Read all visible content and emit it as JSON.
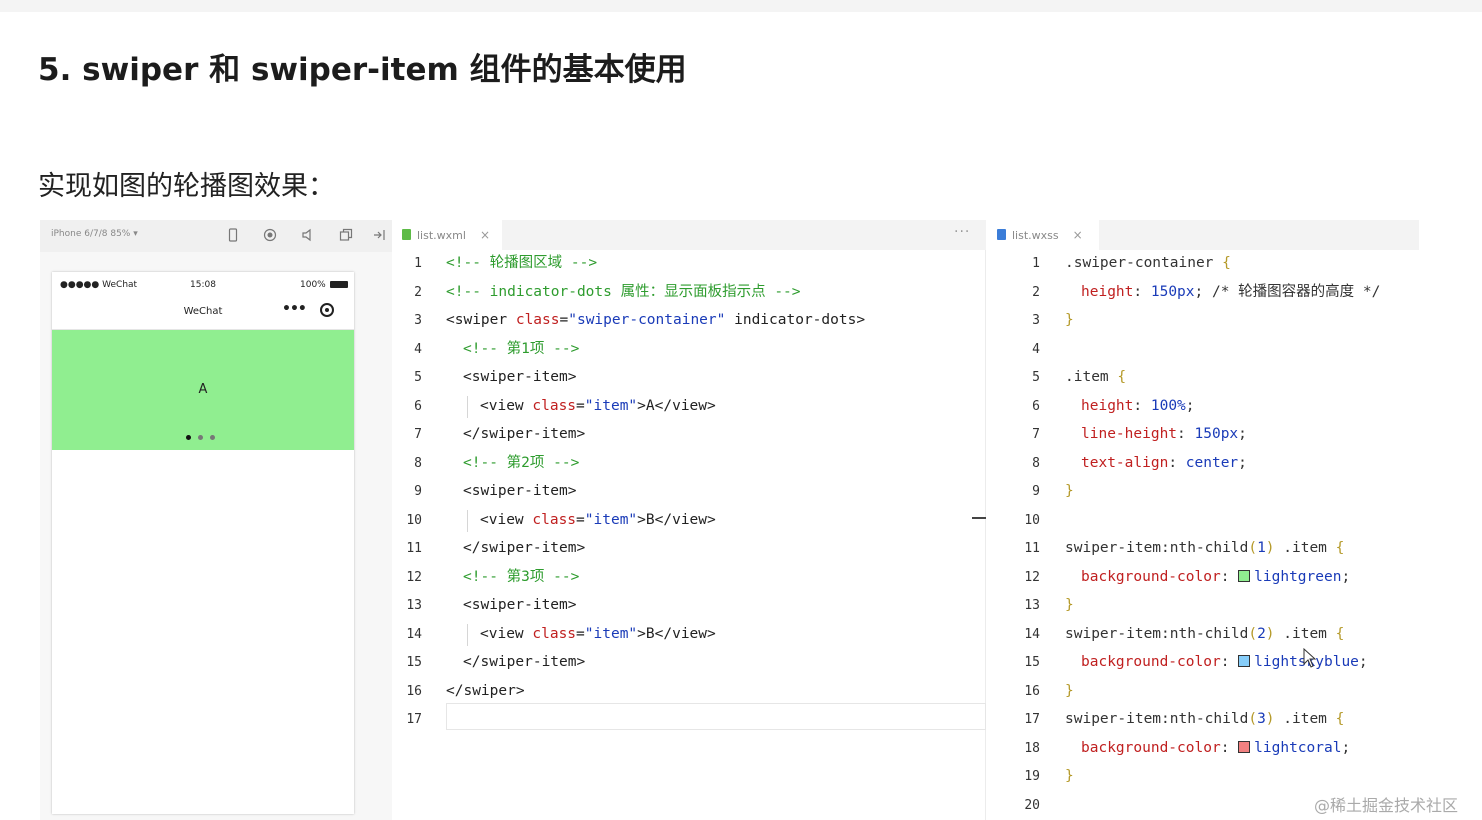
{
  "slide": {
    "title": "5. swiper 和 swiper-item 组件的基本使用",
    "subtitle": "实现如图的轮播图效果："
  },
  "simulator": {
    "device": "iPhone 6/7/8 85% ▾",
    "status_left": "●●●●● WeChat",
    "status_time": "15:08",
    "status_battery": "100%",
    "nav_title": "WeChat",
    "nav_more": "•••",
    "swiper_text": "A",
    "swiper_color": "#90ee90",
    "dots_count": 3,
    "dots_active": 1
  },
  "wxml_editor": {
    "tab_name": "list.wxml",
    "tab_close": "×",
    "more": "···",
    "lines": [
      {
        "n": "1",
        "indent": 0,
        "tokens": [
          {
            "t": "<!-- 轮播图区域 -->",
            "c": "comment"
          }
        ]
      },
      {
        "n": "2",
        "indent": 0,
        "tokens": [
          {
            "t": "<!-- indicator-dots 属性：显示面板指示点 -->",
            "c": "comment"
          }
        ]
      },
      {
        "n": "3",
        "indent": 0,
        "tokens": [
          {
            "t": "<swiper ",
            "c": "tag"
          },
          {
            "t": "class",
            "c": "attr"
          },
          {
            "t": "=",
            "c": "tag"
          },
          {
            "t": "\"swiper-container\"",
            "c": "str"
          },
          {
            "t": " indicator-dots>",
            "c": "tag"
          }
        ]
      },
      {
        "n": "4",
        "indent": 1,
        "tokens": [
          {
            "t": "<!-- 第1项 -->",
            "c": "comment"
          }
        ]
      },
      {
        "n": "5",
        "indent": 1,
        "tokens": [
          {
            "t": "<swiper-item>",
            "c": "tag"
          }
        ]
      },
      {
        "n": "6",
        "indent": 2,
        "tokens": [
          {
            "t": "<view ",
            "c": "tag"
          },
          {
            "t": "class",
            "c": "attr"
          },
          {
            "t": "=",
            "c": "tag"
          },
          {
            "t": "\"item\"",
            "c": "str"
          },
          {
            "t": ">A</view>",
            "c": "tag"
          }
        ]
      },
      {
        "n": "7",
        "indent": 1,
        "tokens": [
          {
            "t": "</swiper-item>",
            "c": "tag"
          }
        ]
      },
      {
        "n": "8",
        "indent": 1,
        "tokens": [
          {
            "t": "<!-- 第2项 -->",
            "c": "comment"
          }
        ]
      },
      {
        "n": "9",
        "indent": 1,
        "tokens": [
          {
            "t": "<swiper-item>",
            "c": "tag"
          }
        ]
      },
      {
        "n": "10",
        "indent": 2,
        "tokens": [
          {
            "t": "<view ",
            "c": "tag"
          },
          {
            "t": "class",
            "c": "attr"
          },
          {
            "t": "=",
            "c": "tag"
          },
          {
            "t": "\"item\"",
            "c": "str"
          },
          {
            "t": ">B</view>",
            "c": "tag"
          }
        ]
      },
      {
        "n": "11",
        "indent": 1,
        "tokens": [
          {
            "t": "</swiper-item>",
            "c": "tag"
          }
        ]
      },
      {
        "n": "12",
        "indent": 1,
        "tokens": [
          {
            "t": "<!-- 第3项 -->",
            "c": "comment"
          }
        ]
      },
      {
        "n": "13",
        "indent": 1,
        "tokens": [
          {
            "t": "<swiper-item>",
            "c": "tag"
          }
        ]
      },
      {
        "n": "14",
        "indent": 2,
        "tokens": [
          {
            "t": "<view ",
            "c": "tag"
          },
          {
            "t": "class",
            "c": "attr"
          },
          {
            "t": "=",
            "c": "tag"
          },
          {
            "t": "\"item\"",
            "c": "str"
          },
          {
            "t": ">B</view>",
            "c": "tag"
          }
        ]
      },
      {
        "n": "15",
        "indent": 1,
        "tokens": [
          {
            "t": "</swiper-item>",
            "c": "tag"
          }
        ]
      },
      {
        "n": "16",
        "indent": 0,
        "tokens": [
          {
            "t": "</swiper>",
            "c": "tag"
          }
        ]
      },
      {
        "n": "17",
        "indent": 0,
        "tokens": []
      }
    ]
  },
  "wxss_editor": {
    "tab_name": "list.wxss",
    "tab_close": "×",
    "lines": [
      {
        "n": "1",
        "indent": 0,
        "tokens": [
          {
            "t": ".swiper-container ",
            "c": "sel"
          },
          {
            "t": "{",
            "c": "brace"
          }
        ]
      },
      {
        "n": "2",
        "indent": 1,
        "tokens": [
          {
            "t": "height",
            "c": "prop"
          },
          {
            "t": ": ",
            "c": "punc"
          },
          {
            "t": "150px",
            "c": "val"
          },
          {
            "t": "; ",
            "c": "punc"
          },
          {
            "t": "/* 轮播图容器的高度 */",
            "c": "sel"
          }
        ]
      },
      {
        "n": "3",
        "indent": 0,
        "tokens": [
          {
            "t": "}",
            "c": "brace"
          }
        ]
      },
      {
        "n": "4",
        "indent": 0,
        "tokens": []
      },
      {
        "n": "5",
        "indent": 0,
        "tokens": [
          {
            "t": ".item ",
            "c": "sel"
          },
          {
            "t": "{",
            "c": "brace"
          }
        ]
      },
      {
        "n": "6",
        "indent": 1,
        "tokens": [
          {
            "t": "height",
            "c": "prop"
          },
          {
            "t": ": ",
            "c": "punc"
          },
          {
            "t": "100%",
            "c": "val"
          },
          {
            "t": ";",
            "c": "punc"
          }
        ]
      },
      {
        "n": "7",
        "indent": 1,
        "tokens": [
          {
            "t": "line-height",
            "c": "prop"
          },
          {
            "t": ": ",
            "c": "punc"
          },
          {
            "t": "150px",
            "c": "val"
          },
          {
            "t": ";",
            "c": "punc"
          }
        ]
      },
      {
        "n": "8",
        "indent": 1,
        "tokens": [
          {
            "t": "text-align",
            "c": "prop"
          },
          {
            "t": ": ",
            "c": "punc"
          },
          {
            "t": "center",
            "c": "val"
          },
          {
            "t": ";",
            "c": "punc"
          }
        ]
      },
      {
        "n": "9",
        "indent": 0,
        "tokens": [
          {
            "t": "}",
            "c": "brace"
          }
        ]
      },
      {
        "n": "10",
        "indent": 0,
        "tokens": []
      },
      {
        "n": "11",
        "indent": 0,
        "tokens": [
          {
            "t": "swiper-item:nth-child",
            "c": "sel"
          },
          {
            "t": "(",
            "c": "brace"
          },
          {
            "t": "1",
            "c": "val"
          },
          {
            "t": ")",
            "c": "brace"
          },
          {
            "t": " .item ",
            "c": "sel"
          },
          {
            "t": "{",
            "c": "brace"
          }
        ]
      },
      {
        "n": "12",
        "indent": 1,
        "tokens": [
          {
            "t": "background-color",
            "c": "prop"
          },
          {
            "t": ": ",
            "c": "punc"
          },
          {
            "t": "",
            "c": "swatch",
            "color": "#90ee90"
          },
          {
            "t": "lightgreen",
            "c": "val"
          },
          {
            "t": ";",
            "c": "punc"
          }
        ]
      },
      {
        "n": "13",
        "indent": 0,
        "tokens": [
          {
            "t": "}",
            "c": "brace"
          }
        ]
      },
      {
        "n": "14",
        "indent": 0,
        "tokens": [
          {
            "t": "swiper-item:nth-child",
            "c": "sel"
          },
          {
            "t": "(",
            "c": "brace"
          },
          {
            "t": "2",
            "c": "val"
          },
          {
            "t": ")",
            "c": "brace"
          },
          {
            "t": " .item ",
            "c": "sel"
          },
          {
            "t": "{",
            "c": "brace"
          }
        ]
      },
      {
        "n": "15",
        "indent": 1,
        "tokens": [
          {
            "t": "background-color",
            "c": "prop"
          },
          {
            "t": ": ",
            "c": "punc"
          },
          {
            "t": "",
            "c": "swatch",
            "color": "#87cefa"
          },
          {
            "t": "lightskyblue",
            "c": "val"
          },
          {
            "t": ";",
            "c": "punc"
          }
        ]
      },
      {
        "n": "16",
        "indent": 0,
        "tokens": [
          {
            "t": "}",
            "c": "brace"
          }
        ]
      },
      {
        "n": "17",
        "indent": 0,
        "tokens": [
          {
            "t": "swiper-item:nth-child",
            "c": "sel"
          },
          {
            "t": "(",
            "c": "brace"
          },
          {
            "t": "3",
            "c": "val"
          },
          {
            "t": ")",
            "c": "brace"
          },
          {
            "t": " .item ",
            "c": "sel"
          },
          {
            "t": "{",
            "c": "brace"
          }
        ]
      },
      {
        "n": "18",
        "indent": 1,
        "tokens": [
          {
            "t": "background-color",
            "c": "prop"
          },
          {
            "t": ": ",
            "c": "punc"
          },
          {
            "t": "",
            "c": "swatch",
            "color": "#f08080"
          },
          {
            "t": "lightcoral",
            "c": "val"
          },
          {
            "t": ";",
            "c": "punc"
          }
        ]
      },
      {
        "n": "19",
        "indent": 0,
        "tokens": [
          {
            "t": "}",
            "c": "brace"
          }
        ]
      },
      {
        "n": "20",
        "indent": 0,
        "tokens": []
      }
    ]
  },
  "watermark": "@稀土掘金技术社区"
}
